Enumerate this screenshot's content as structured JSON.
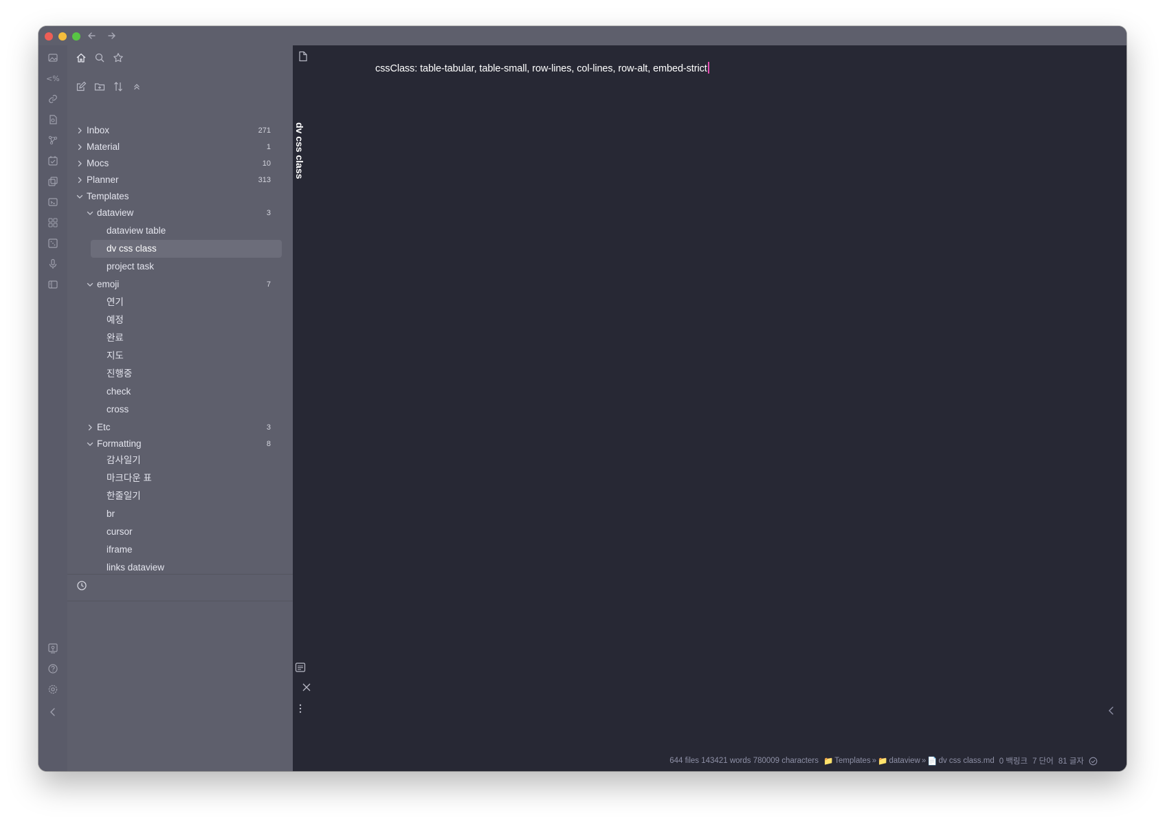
{
  "titlebar": {
    "back_icon": "arrow-left-icon",
    "forward_icon": "arrow-right-icon"
  },
  "ribbon": {
    "icons": [
      "image-icon",
      "template-code-icon",
      "link-icon",
      "file-search-icon",
      "graph-icon",
      "calendar-check-icon",
      "copy-icon",
      "terminal-icon",
      "grid-icon",
      "dice-icon",
      "microphone-icon",
      "sidebar-layout-icon"
    ],
    "bottom_icons": [
      "vault-icon",
      "help-icon",
      "settings-icon",
      "collapse-left-icon"
    ]
  },
  "sidebar": {
    "tabs": [
      "home-icon",
      "search-icon",
      "star-icon"
    ],
    "nav_actions": [
      "new-note-icon",
      "new-folder-icon",
      "sort-icon",
      "collapse-all-icon"
    ],
    "tree": [
      {
        "label": "Inbox",
        "count": "271",
        "collapsed": true
      },
      {
        "label": "Material",
        "count": "1",
        "collapsed": true
      },
      {
        "label": "Mocs",
        "count": "10",
        "collapsed": true
      },
      {
        "label": "Planner",
        "count": "313",
        "collapsed": true
      },
      {
        "label": "Templates",
        "count": "",
        "collapsed": false
      },
      {
        "label": "dataview",
        "count": "3",
        "collapsed": false
      },
      {
        "label": "dataview table",
        "count": ""
      },
      {
        "label": "dv css class",
        "count": "",
        "active": true
      },
      {
        "label": "project task",
        "count": ""
      },
      {
        "label": "emoji",
        "count": "7",
        "collapsed": false
      },
      {
        "label": "연기",
        "count": ""
      },
      {
        "label": "예정",
        "count": ""
      },
      {
        "label": "완료",
        "count": ""
      },
      {
        "label": "지도",
        "count": ""
      },
      {
        "label": "진행중",
        "count": ""
      },
      {
        "label": "check",
        "count": ""
      },
      {
        "label": "cross",
        "count": ""
      },
      {
        "label": "Etc",
        "count": "3",
        "collapsed": true
      },
      {
        "label": "Formatting",
        "count": "8",
        "collapsed": false
      },
      {
        "label": "감사일기",
        "count": ""
      },
      {
        "label": "마크다운 표",
        "count": ""
      },
      {
        "label": "한줄일기",
        "count": ""
      },
      {
        "label": "br",
        "count": ""
      },
      {
        "label": "cursor",
        "count": ""
      },
      {
        "label": "iframe",
        "count": ""
      },
      {
        "label": "links dataview",
        "count": ""
      }
    ],
    "recent_icon": "clock-icon"
  },
  "editor": {
    "vertical_title": "dv css class",
    "content_line": "cssClass: table-tabular, table-small, row-lines, col-lines, row-alt, embed-strict",
    "cursor_color": "#e84fb6",
    "left_icons": [
      "file-icon",
      "reading-view-icon",
      "close-icon",
      "more-options-icon"
    ],
    "right_collapse_icon": "chevron-left-icon"
  },
  "statusbar": {
    "vault_stats": "644 files 143421 words 780009 characters",
    "breadcrumb": [
      "Templates",
      "dataview",
      "dv css class.md"
    ],
    "separator": "»",
    "backlinks": "0 백링크",
    "words": "7 단어",
    "chars": "81 글자",
    "sync_icon": "check-circle-icon"
  },
  "colors": {
    "sidebar_bg": "#5e5f6c",
    "editor_bg": "#272834",
    "accent": "#e84fb6",
    "status_text": "#8e90a6"
  }
}
